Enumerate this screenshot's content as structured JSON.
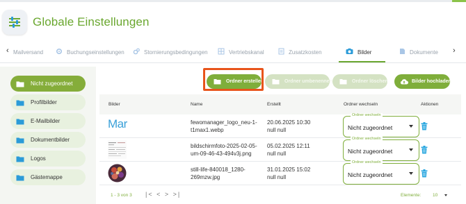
{
  "header": {
    "title": "Globale Einstellungen"
  },
  "tabs": {
    "scroll_left": "‹",
    "scroll_right": "›",
    "items": [
      {
        "label": "Mailversand",
        "icon": "mail-icon"
      },
      {
        "label": "Buchungseinstellungen",
        "icon": "gear-icon"
      },
      {
        "label": "Stornierungsbedingungen",
        "icon": "gears-icon"
      },
      {
        "label": "Vertriebskanal",
        "icon": "grid-icon"
      },
      {
        "label": "Zusatzkosten",
        "icon": "receipt-icon"
      },
      {
        "label": "Bilder",
        "icon": "camera-icon",
        "active": true
      },
      {
        "label": "Dokumente",
        "icon": "document-icon"
      }
    ]
  },
  "sidebar": {
    "folders": [
      {
        "label": "Nicht zugeordnet",
        "active": true
      },
      {
        "label": "Profilbilder"
      },
      {
        "label": "E-Mailbilder"
      },
      {
        "label": "Dokumentbilder"
      },
      {
        "label": "Logos"
      },
      {
        "label": "Gästemappe"
      }
    ]
  },
  "toolbar": {
    "create_folder": "Ordner erstellen",
    "rename_folder": "Ordner umbenennen",
    "delete_folder": "Ordner löschen",
    "upload_images": "Bilder hochladen"
  },
  "table": {
    "headers": {
      "images": "Bilder",
      "name": "Name",
      "created": "Erstellt",
      "change_folder": "Ordner wechseln",
      "actions": "Aktionen"
    },
    "select_label": "Ordner wechseln",
    "rows": [
      {
        "name_line1": "fewomanager_logo_neu-1-",
        "name_line2": "t1max1.webp",
        "date": "20.06.2025 10:30",
        "user": "null null",
        "folder": "Nicht zugeordnet",
        "thumb": "logo"
      },
      {
        "name_line1": "bildschirmfoto-2025-02-05-",
        "name_line2": "um-09-46-43-494v3j.png",
        "date": "05.02.2025 12:11",
        "user": "null null",
        "folder": "Nicht zugeordnet",
        "thumb": "screenshot"
      },
      {
        "name_line1": "still-life-840018_1280-",
        "name_line2": "269mzw.jpg",
        "date": "31.01.2025 15:02",
        "user": "null null",
        "folder": "Nicht zugeordnet",
        "thumb": "photo"
      }
    ],
    "thumb_logo_text": "Mar"
  },
  "footer": {
    "range": "1 - 3 von 3",
    "pager": "|< < > >|",
    "per_page_label": "Elemente:",
    "per_page_value": "10"
  },
  "colors": {
    "accent": "#7fae3b",
    "title": "#6aa72f",
    "highlight": "#e8541b",
    "trash": "#2aa7e0"
  }
}
